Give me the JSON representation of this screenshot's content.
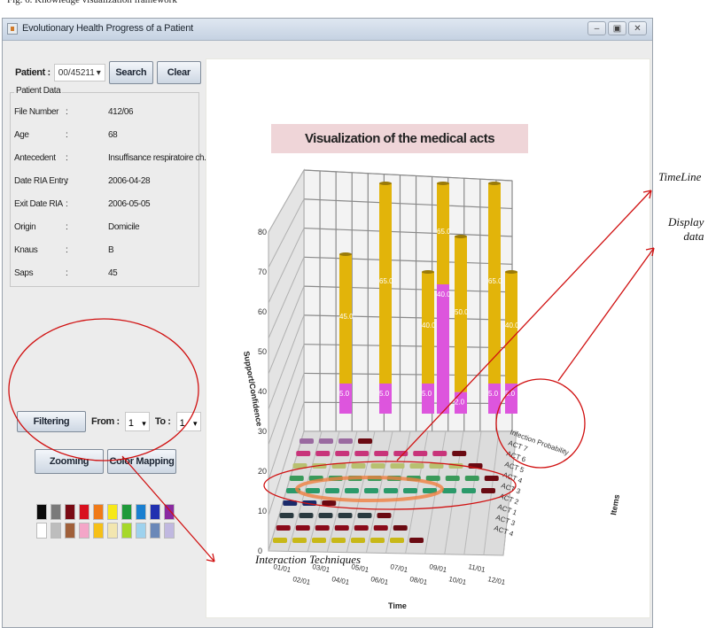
{
  "figure_caption": "Fig. 6.   Knowledge visualization framework",
  "window": {
    "title": "Evolutionary Health Progress of a Patient",
    "controls": {
      "minimize": "‒",
      "maximize": "▣",
      "close": "✕"
    }
  },
  "patient_search": {
    "label": "Patient :",
    "selected_value": "00/45211",
    "search_label": "Search",
    "clear_label": "Clear"
  },
  "patient_data": {
    "title": "Patient Data",
    "rows": [
      {
        "key": "File Number",
        "value": "412/06"
      },
      {
        "key": "Age",
        "value": "68"
      },
      {
        "key": "Antecedent",
        "value": "Insuffisance respiratoire ch..."
      },
      {
        "key": "Date RIA Entry",
        "value": "2006-04-28"
      },
      {
        "key": "Exit Date RIA",
        "value": "2006-05-05"
      },
      {
        "key": "Origin",
        "value": "Domicile"
      },
      {
        "key": "Knaus",
        "value": "B"
      },
      {
        "key": "Saps",
        "value": "45"
      }
    ],
    "separator": ":"
  },
  "interaction": {
    "filtering_label": "Filtering",
    "from_label": "From :",
    "from_value": "1",
    "to_label": "To :",
    "to_value": "1",
    "zooming_label": "Zooming",
    "color_mapping_label": "Color Mapping"
  },
  "palette": {
    "row1": [
      "#0a0a0a",
      "#7a7a7a",
      "#7a0a14",
      "#d8101e",
      "#f07a18",
      "#f7e818",
      "#1f9a3a",
      "#1a7fd0",
      "#2030b0",
      "#8a2aa0"
    ],
    "row2": [
      "#ffffff",
      "#bdbdbd",
      "#a0603a",
      "#f4a6c8",
      "#f6c018",
      "#f2e6b0",
      "#a6d82a",
      "#9ed2ee",
      "#6a88b8",
      "#c0b8e0"
    ]
  },
  "annotations": {
    "timeline": "TimeLine",
    "display_data": "Display\ndata",
    "interaction_techniques": "Interaction Techniques"
  },
  "chart_data": {
    "type": "bar",
    "title": "Visualization of the medical acts",
    "xlabel": "Time",
    "ylabel": "Support/Confidence",
    "zlabel": "Items",
    "ylim": [
      0,
      80
    ],
    "y_ticks": [
      "0",
      "10",
      "20",
      "30",
      "40",
      "50",
      "60",
      "70",
      "80"
    ],
    "x_ticks": [
      "01/01",
      "02/01",
      "03/01",
      "04/01",
      "05/01",
      "06/01",
      "07/01",
      "08/01",
      "09/01",
      "10/01",
      "11/01",
      "12/01"
    ],
    "items": [
      "Infection Probability",
      "ACT 7",
      "ACT 6",
      "ACT 5",
      "ACT 4",
      "ACT 3",
      "ACT 2",
      "ACT 1",
      "ACT 3",
      "ACT 4"
    ],
    "bar_colors": {
      "support": "#e2b40a",
      "confidence": "#dd55dd"
    },
    "bars": [
      {
        "x": "03/01",
        "confidence": 5,
        "support": 45,
        "labels": [
          "5.0",
          "45.0"
        ]
      },
      {
        "x": "05/01",
        "confidence": 5,
        "support": 65,
        "labels": [
          "5.0",
          "65.0"
        ]
      },
      {
        "x": "07/01",
        "confidence": 5,
        "support": 40,
        "labels": [
          "5.0",
          "40.0"
        ]
      },
      {
        "x": "08/01",
        "confidence": 40,
        "support": 65,
        "labels": [
          "40.0",
          "65.0"
        ]
      },
      {
        "x": "09/01",
        "confidence": 2,
        "support": 50,
        "labels": [
          "2.0",
          "50.0"
        ]
      },
      {
        "x": "11/01",
        "confidence": 5,
        "support": 65,
        "labels": [
          "5.0",
          "65.0"
        ]
      },
      {
        "x": "12/01",
        "confidence": 5,
        "support": 40,
        "labels": [
          "5.0",
          "40.0"
        ]
      }
    ],
    "timeline_rows": [
      {
        "item": "ACT 7",
        "color": "#9a6aa0",
        "count": 4
      },
      {
        "item": "ACT 6",
        "color": "#c8347a",
        "count": 9
      },
      {
        "item": "ACT 5",
        "color": "#b8c070",
        "count": 10
      },
      {
        "item": "ACT 4",
        "color": "#3a9a5a",
        "count": 11
      },
      {
        "item": "ACT 3",
        "color": "#2a9a6a",
        "count": 11
      },
      {
        "item": "ACT 2",
        "color": "#1a2a6a",
        "count": 3
      },
      {
        "item": "ACT 1",
        "color": "#2a3a40",
        "count": 6
      },
      {
        "item": "ACT 3",
        "color": "#8a0a1a",
        "count": 7
      },
      {
        "item": "ACT 4",
        "color": "#c8b818",
        "count": 8
      }
    ]
  }
}
